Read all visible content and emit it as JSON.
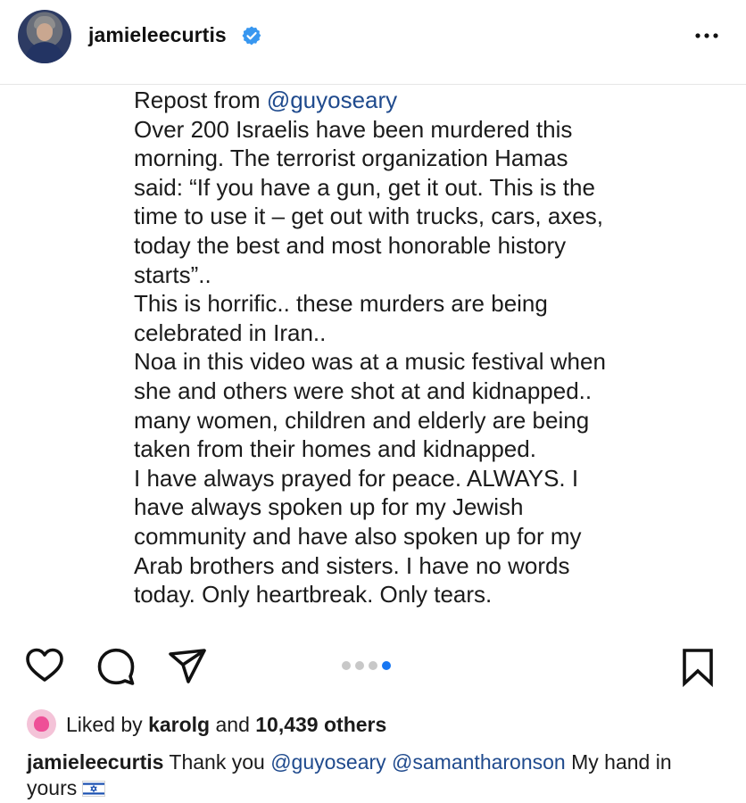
{
  "header": {
    "username": "jamieleecurtis",
    "verified_icon": "verified-badge-icon",
    "more_icon": "more-options-icon",
    "accent_color": "#3897f0"
  },
  "post": {
    "lines": [
      {
        "prefix": "Repost from ",
        "mention": "@guyoseary",
        "suffix": ""
      },
      {
        "prefix": "Over 200 Israelis have been murdered this",
        "mention": "",
        "suffix": ""
      },
      {
        "prefix": "morning. The terrorist organization Hamas",
        "mention": "",
        "suffix": ""
      },
      {
        "prefix": "said: “If you have a gun, get it out. This is the",
        "mention": "",
        "suffix": ""
      },
      {
        "prefix": "time to use it – get out with trucks, cars, axes,",
        "mention": "",
        "suffix": ""
      },
      {
        "prefix": "today the best and most honorable history",
        "mention": "",
        "suffix": ""
      },
      {
        "prefix": "starts”..",
        "mention": "",
        "suffix": ""
      },
      {
        "prefix": "This is horrific.. these murders are being",
        "mention": "",
        "suffix": ""
      },
      {
        "prefix": "celebrated in Iran..",
        "mention": "",
        "suffix": ""
      },
      {
        "prefix": "Noa in this video was at a music festival when",
        "mention": "",
        "suffix": ""
      },
      {
        "prefix": "she and others were shot at and kidnapped..",
        "mention": "",
        "suffix": ""
      },
      {
        "prefix": "many women, children and elderly are being",
        "mention": "",
        "suffix": ""
      },
      {
        "prefix": "taken from their homes and kidnapped.",
        "mention": "",
        "suffix": ""
      },
      {
        "prefix": "I have always prayed for peace. ALWAYS. I",
        "mention": "",
        "suffix": ""
      },
      {
        "prefix": "have always spoken up for my Jewish",
        "mention": "",
        "suffix": ""
      },
      {
        "prefix": "community and have also spoken up for my",
        "mention": "",
        "suffix": ""
      },
      {
        "prefix": "Arab brothers and sisters. I have no words",
        "mention": "",
        "suffix": ""
      },
      {
        "prefix": "today. Only heartbreak. Only tears.",
        "mention": "",
        "suffix": ""
      }
    ]
  },
  "actions": {
    "like_icon": "heart-icon",
    "comment_icon": "comment-icon",
    "share_icon": "share-icon",
    "save_icon": "bookmark-icon"
  },
  "carousel": {
    "total": 4,
    "active_index": 3,
    "active_color": "#1877f2"
  },
  "likes": {
    "prefix": "Liked by ",
    "user": "karolg",
    "middle": " and ",
    "count": "10,439 others"
  },
  "caption": {
    "username": "jamieleecurtis",
    "text_1": " Thank you ",
    "mention_1": "@guyoseary",
    "space": " ",
    "mention_2": "@samantharonson",
    "text_2": " My hand in yours",
    "flag_icon": "israel-flag-icon"
  }
}
